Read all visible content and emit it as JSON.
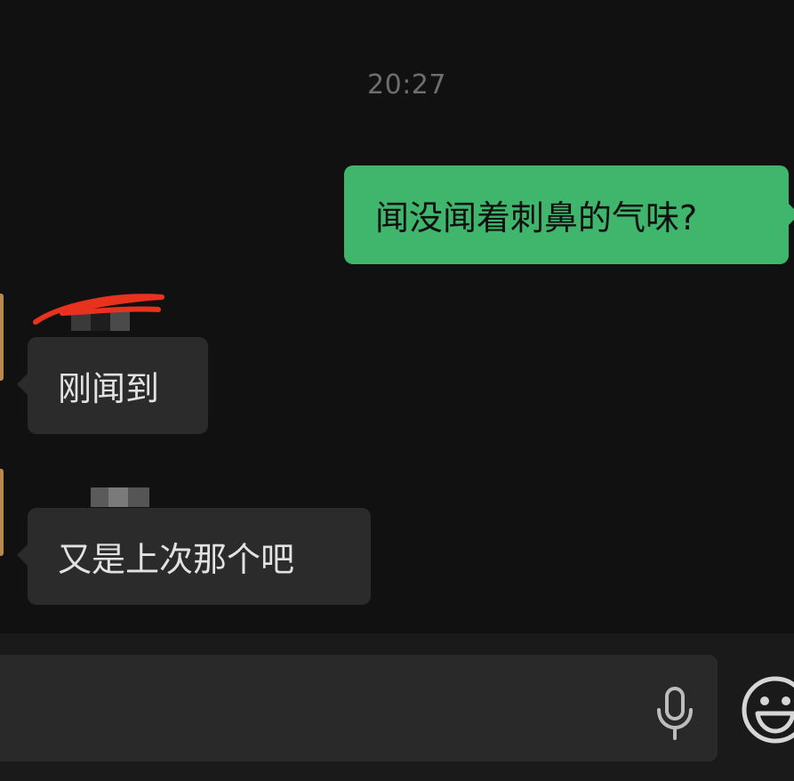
{
  "conversation": {
    "timestamp": "20:27",
    "messages": [
      {
        "direction": "outgoing",
        "text": "闻没闻着刺鼻的气味?"
      },
      {
        "direction": "incoming",
        "text": "刚闻到"
      },
      {
        "direction": "incoming",
        "text": "又是上次那个吧"
      }
    ]
  },
  "input_bar": {
    "value": "",
    "placeholder": "",
    "voice_icon": "microphone-icon",
    "emoji_icon": "smiley-face-icon"
  },
  "colors": {
    "background": "#111111",
    "outgoing_bubble": "#3fb66b",
    "incoming_bubble": "#2b2b2b",
    "timestamp_text": "#6e6e6e",
    "redaction_scribble": "#e8321e"
  }
}
